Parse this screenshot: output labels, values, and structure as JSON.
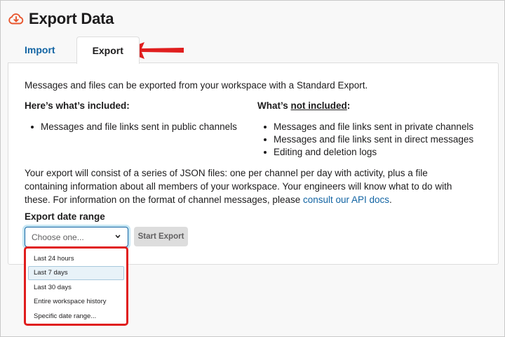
{
  "header": {
    "title": "Export Data",
    "icon": "cloud-download-icon",
    "icon_color": "#e8552d"
  },
  "tabs": [
    {
      "label": "Import",
      "active": false
    },
    {
      "label": "Export",
      "active": true
    }
  ],
  "annotation": {
    "arrow_color": "#e01e1e",
    "highlight_color": "#e01e1e"
  },
  "panel": {
    "intro": "Messages and files can be exported from your workspace with a Standard Export.",
    "included": {
      "title": "Here’s what’s included:",
      "items": [
        "Messages and file links sent in public channels"
      ]
    },
    "not_included": {
      "title_prefix": "What’s ",
      "title_underlined": "not included",
      "title_suffix": ":",
      "items": [
        "Messages and file links sent in private channels",
        "Messages and file links sent in direct messages",
        "Editing and deletion logs"
      ]
    },
    "description": "Your export will consist of a series of JSON files: one per channel per day with activity, plus a file containing information about all members of your workspace. Your engineers will know what to do with these. For information on the format of channel messages, please ",
    "description_link": "consult our API docs",
    "description_end": ".",
    "range_label": "Export date range",
    "select_placeholder": "Choose one...",
    "start_button": "Start Export"
  },
  "dropdown": {
    "options": [
      "Last 24 hours",
      "Last 7 days",
      "Last 30 days",
      "Entire workspace history",
      "Specific date range..."
    ],
    "highlighted": "Last 7 days"
  },
  "colors": {
    "link": "#1264a3",
    "text": "#1d1c1d",
    "focus_border": "#1264a3"
  }
}
